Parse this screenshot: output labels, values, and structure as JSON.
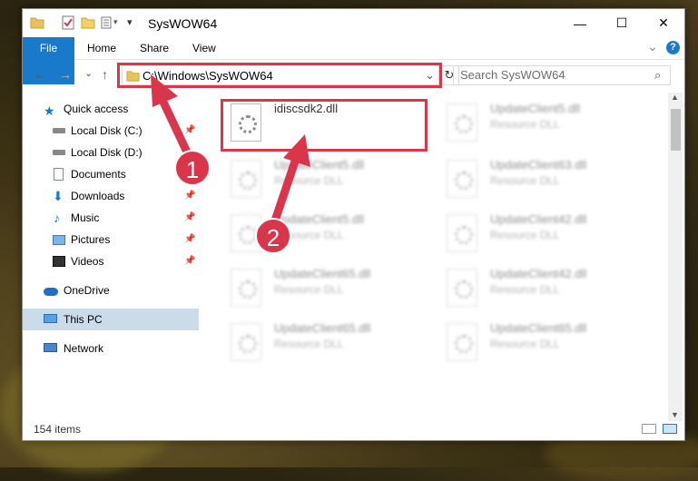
{
  "window": {
    "title": "SysWOW64",
    "minimize_glyph": "—",
    "maximize_glyph": "☐",
    "close_glyph": "✕"
  },
  "ribbon": {
    "tabs": [
      "File",
      "Home",
      "Share",
      "View"
    ],
    "expand_glyph": "⌄",
    "help_glyph": "?"
  },
  "nav": {
    "back_glyph": "←",
    "forward_glyph": "→",
    "recent_glyph": "⌄",
    "up_glyph": "↑",
    "address": "C:\\Windows\\SysWOW64",
    "address_dropdown_glyph": "⌄",
    "refresh_glyph": "↻",
    "search_placeholder": "Search SysWOW64"
  },
  "sidebar": {
    "items": [
      {
        "label": "Quick access",
        "icon": "star-icon",
        "pinned": false
      },
      {
        "label": "Local Disk (C:)",
        "icon": "drive-icon",
        "pinned": true
      },
      {
        "label": "Local Disk (D:)",
        "icon": "drive-icon",
        "pinned": false
      },
      {
        "label": "Documents",
        "icon": "documents-icon",
        "pinned": true
      },
      {
        "label": "Downloads",
        "icon": "download-icon",
        "pinned": true
      },
      {
        "label": "Music",
        "icon": "music-icon",
        "pinned": true
      },
      {
        "label": "Pictures",
        "icon": "pictures-icon",
        "pinned": true
      },
      {
        "label": "Videos",
        "icon": "videos-icon",
        "pinned": true
      },
      {
        "label": "OneDrive",
        "icon": "cloud-icon",
        "pinned": false
      },
      {
        "label": "This PC",
        "icon": "computer-icon",
        "pinned": false
      },
      {
        "label": "Network",
        "icon": "network-icon",
        "pinned": false
      }
    ],
    "pin_glyph": "📌"
  },
  "files": [
    {
      "name": "idiscsdk2.dll",
      "type": "",
      "blurred": false
    },
    {
      "name": "UpdateClient5.dll",
      "type": "Resource DLL",
      "blurred": true
    },
    {
      "name": "UpdateClient5.dll",
      "type": "Resource DLL",
      "blurred": true
    },
    {
      "name": "UpdateClient63.dll",
      "type": "Resource DLL",
      "blurred": true
    },
    {
      "name": "UpdateClient5.dll",
      "type": "Resource DLL",
      "blurred": true
    },
    {
      "name": "UpdateClient42.dll",
      "type": "Resource DLL",
      "blurred": true
    },
    {
      "name": "UpdateClient65.dll",
      "type": "Resource DLL",
      "blurred": true
    },
    {
      "name": "UpdateClient42.dll",
      "type": "Resource DLL",
      "blurred": true
    },
    {
      "name": "UpdateClient65.dll",
      "type": "Resource DLL",
      "blurred": true
    },
    {
      "name": "UpdateClient65.dll",
      "type": "Resource DLL",
      "blurred": true
    }
  ],
  "status": {
    "item_count": "154 items"
  },
  "annotations": {
    "step1": "1",
    "step2": "2",
    "color": "#d9364b"
  }
}
